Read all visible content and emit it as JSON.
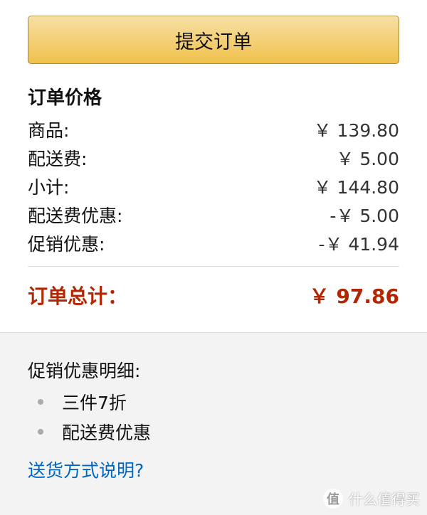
{
  "submit_button": {
    "label": "提交订单"
  },
  "order_summary": {
    "title": "订单价格",
    "lines": [
      {
        "label": "商品:",
        "value": "￥ 139.80"
      },
      {
        "label": "配送费:",
        "value": "￥ 5.00"
      },
      {
        "label": "小计:",
        "value": "￥ 144.80"
      },
      {
        "label": "配送费优惠:",
        "value": "-￥ 5.00"
      },
      {
        "label": "促销优惠:",
        "value": "-￥ 41.94"
      }
    ],
    "total": {
      "label": "订单总计：",
      "value": "￥ 97.86"
    }
  },
  "promotions": {
    "title": "促销优惠明细:",
    "items": [
      "三件7折",
      "配送费优惠"
    ]
  },
  "shipping_link": {
    "label": "送货方式说明?"
  },
  "watermark": {
    "text": "值 什么值得买"
  },
  "colors": {
    "button_top": "#f7dfa5",
    "button_bottom": "#f0c14b",
    "total_red": "#b12704",
    "link_blue": "#0066c0",
    "gray_bg": "#f3f3f3"
  }
}
